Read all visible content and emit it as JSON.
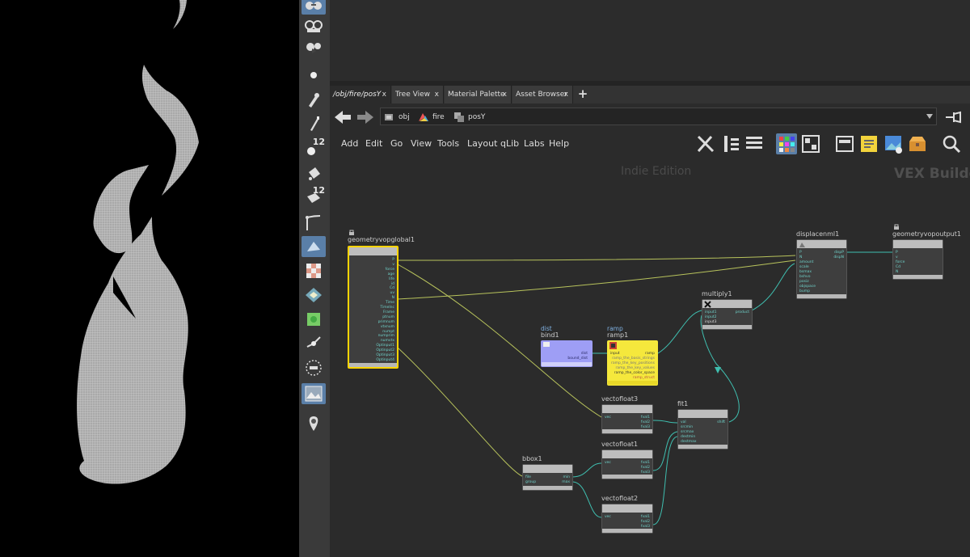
{
  "viewport": {
    "background": "#000000",
    "mesh_color": "#b8b8b8"
  },
  "toolbar": {
    "badges": [
      "12",
      "12"
    ],
    "icons": [
      "view-glasses-icon",
      "camera-glasses-icon",
      "sphere-icon",
      "brush-icon",
      "paint-brush-icon",
      "pin-12-icon",
      "fill-bucket-icon",
      "box-12-icon",
      "curve-icon",
      "sculpt-icon",
      "checker-icon",
      "diamond-icon",
      "green-tile-icon",
      "joint-icon",
      "circle-dots-icon",
      "landscape-icon",
      "map-pin-icon"
    ]
  },
  "tabs": [
    {
      "label": "/obj/fire/posY",
      "active": true
    },
    {
      "label": "Tree View"
    },
    {
      "label": "Material Palette"
    },
    {
      "label": "Asset Browser"
    }
  ],
  "add_tab_label": "+",
  "tab_close": "x",
  "breadcrumbs": [
    {
      "label": "obj"
    },
    {
      "label": "fire"
    },
    {
      "label": "posY"
    }
  ],
  "menu": [
    "Add",
    "Edit",
    "Go",
    "View",
    "Tools",
    "Layout",
    "qLib",
    "Labs",
    "Help"
  ],
  "network": {
    "watermark": "Indie Edition",
    "context": "VEX Builder",
    "nodes": {
      "geometryvopglobal1": {
        "title": "geometryvopglobal1",
        "outputs": [
          "P",
          "v",
          "force",
          "age",
          "life",
          "id",
          "Cd",
          "uv",
          "N",
          "Time",
          "TimeInc",
          "Frame",
          "ptnum",
          "primnum",
          "vtxnum",
          "numpt",
          "numprim",
          "numvtx",
          "Optinput1",
          "Optinput2",
          "Optinput3",
          "Optinput4"
        ]
      },
      "bind1": {
        "title": "bind1",
        "sub": "dist",
        "outputs": [
          "dist",
          "bound_dist"
        ]
      },
      "ramp1": {
        "title": "ramp1",
        "sub": "ramp",
        "inputs": [
          "input"
        ],
        "outputs": [
          "ramp",
          "ramp_the_basis_strings",
          "ramp_the_key_positions",
          "ramp_the_key_values",
          "ramp_the_color_space",
          "ramp_struct"
        ]
      },
      "multiply1": {
        "title": "multiply1",
        "inputs": [
          "input1",
          "input2",
          "input3"
        ],
        "outputs": [
          "product"
        ]
      },
      "displacenml1": {
        "title": "displacenml1",
        "inputs": [
          "P",
          "N",
          "amount",
          "scale",
          "bsmax",
          "bshvo",
          "posiz",
          "objspace",
          "bump"
        ],
        "outputs": [
          "dispP",
          "dispN"
        ]
      },
      "geometryvopoutput1": {
        "title": "geometryvopoutput1",
        "inputs": [
          "P",
          "v",
          "force",
          "Cd",
          "N"
        ]
      },
      "vectofloat3": {
        "title": "vectofloat3",
        "inputs": [
          "vec"
        ],
        "outputs": [
          "fval1",
          "fval2",
          "fval3"
        ]
      },
      "vectofloat1": {
        "title": "vectofloat1",
        "inputs": [
          "vec"
        ],
        "outputs": [
          "fval1",
          "fval2",
          "fval3"
        ]
      },
      "vectofloat2": {
        "title": "vectofloat2",
        "inputs": [
          "vec"
        ],
        "outputs": [
          "fval1",
          "fval2",
          "fval3"
        ]
      },
      "fit1": {
        "title": "fit1",
        "inputs": [
          "val",
          "srcmin",
          "srcmax",
          "destmin",
          "destmax"
        ],
        "outputs": [
          "shift"
        ]
      },
      "bbox1": {
        "title": "bbox1",
        "inputs": [
          "file",
          "group"
        ],
        "outputs": [
          "min",
          "max"
        ]
      }
    }
  },
  "colors": {
    "accent": "#5a7fa8",
    "node_selected": "#ffd400",
    "bind_node": "#9e9ef5",
    "ramp_node": "#f5e83c",
    "wire_yellow": "#b8c35c",
    "wire_teal": "#3fbfb0"
  }
}
